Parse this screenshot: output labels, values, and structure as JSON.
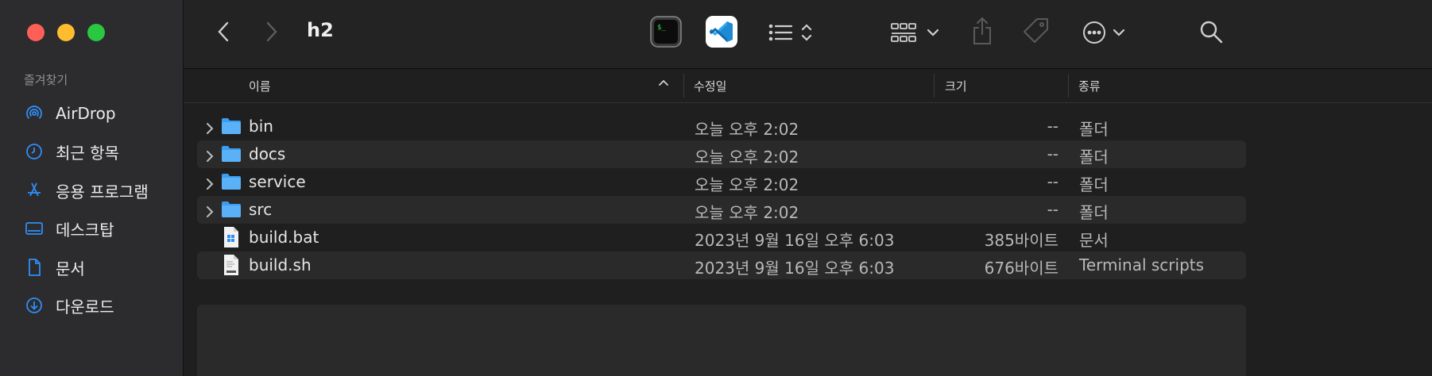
{
  "window": {
    "title": "h2",
    "traffic_colors": [
      "#fe5f57",
      "#febc2e",
      "#28c840"
    ]
  },
  "sidebar": {
    "section_title": "즐겨찾기",
    "items": [
      {
        "label": "AirDrop",
        "icon": "airdrop-icon"
      },
      {
        "label": "최근 항목",
        "icon": "clock-icon"
      },
      {
        "label": "응용 프로그램",
        "icon": "applications-icon"
      },
      {
        "label": "데스크탑",
        "icon": "desktop-icon"
      },
      {
        "label": "문서",
        "icon": "document-icon"
      },
      {
        "label": "다운로드",
        "icon": "download-icon"
      }
    ],
    "accent_color": "#2f8ef7"
  },
  "toolbar": {
    "icons": [
      "back-chevron-icon",
      "forward-chevron-icon",
      "terminal-app-icon",
      "vscode-app-icon",
      "list-view-icon",
      "grid-view-icon",
      "share-icon",
      "tag-icon",
      "more-icon",
      "search-icon"
    ]
  },
  "columns": {
    "name": "이름",
    "modified": "수정일",
    "size": "크기",
    "kind": "종류"
  },
  "files": [
    {
      "name": "bin",
      "date": "오늘 오후 2:02",
      "size": "--",
      "kind": "폴더",
      "type": "folder"
    },
    {
      "name": "docs",
      "date": "오늘 오후 2:02",
      "size": "--",
      "kind": "폴더",
      "type": "folder"
    },
    {
      "name": "service",
      "date": "오늘 오후 2:02",
      "size": "--",
      "kind": "폴더",
      "type": "folder"
    },
    {
      "name": "src",
      "date": "오늘 오후 2:02",
      "size": "--",
      "kind": "폴더",
      "type": "folder"
    },
    {
      "name": "build.bat",
      "date": "2023년 9월 16일 오후 6:03",
      "size": "385바이트",
      "kind": "문서",
      "type": "bat-file"
    },
    {
      "name": "build.sh",
      "date": "2023년 9월 16일 오후 6:03",
      "size": "676바이트",
      "kind": "Terminal scripts",
      "type": "shell-file"
    }
  ]
}
